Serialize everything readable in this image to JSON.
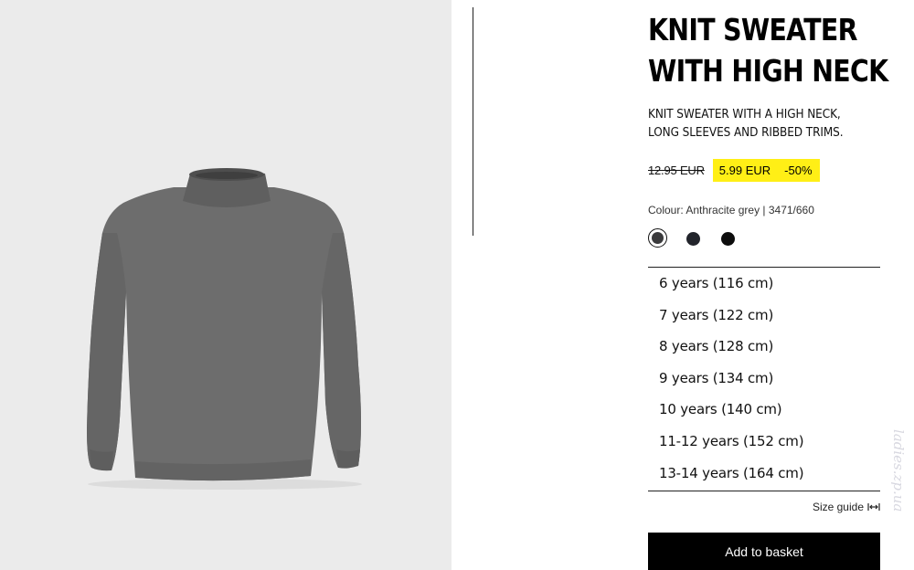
{
  "product": {
    "title_line1": "KNIT SWEATER",
    "title_line2": "WITH HIGH NECK",
    "description_line1": "KNIT SWEATER WITH A HIGH NECK,",
    "description_line2": "LONG SLEEVES AND RIBBED TRIMS.",
    "old_price": "12.95 EUR",
    "new_price": "5.99 EUR",
    "discount": "-50%",
    "colour_label": "Colour: Anthracite grey | 3471/660"
  },
  "swatches": [
    {
      "name": "Anthracite grey",
      "color": "#3a3a3c",
      "selected": true
    },
    {
      "name": "navy",
      "color": "#22242b",
      "selected": false
    },
    {
      "name": "black",
      "color": "#0d0d0d",
      "selected": false
    }
  ],
  "sizes": [
    "6 years (116 cm)",
    "7 years (122 cm)",
    "8 years (128 cm)",
    "9 years (134 cm)",
    "10 years (140 cm)",
    "11-12 years (152 cm)",
    "13-14 years (164 cm)"
  ],
  "size_guide_label": "Size guide",
  "add_to_basket_label": "Add to basket",
  "watermark": "ladies.zp.ua",
  "colors": {
    "sale_highlight": "#ffef16",
    "image_background": "#ebebeb",
    "sweater": "#6b6b6b"
  }
}
